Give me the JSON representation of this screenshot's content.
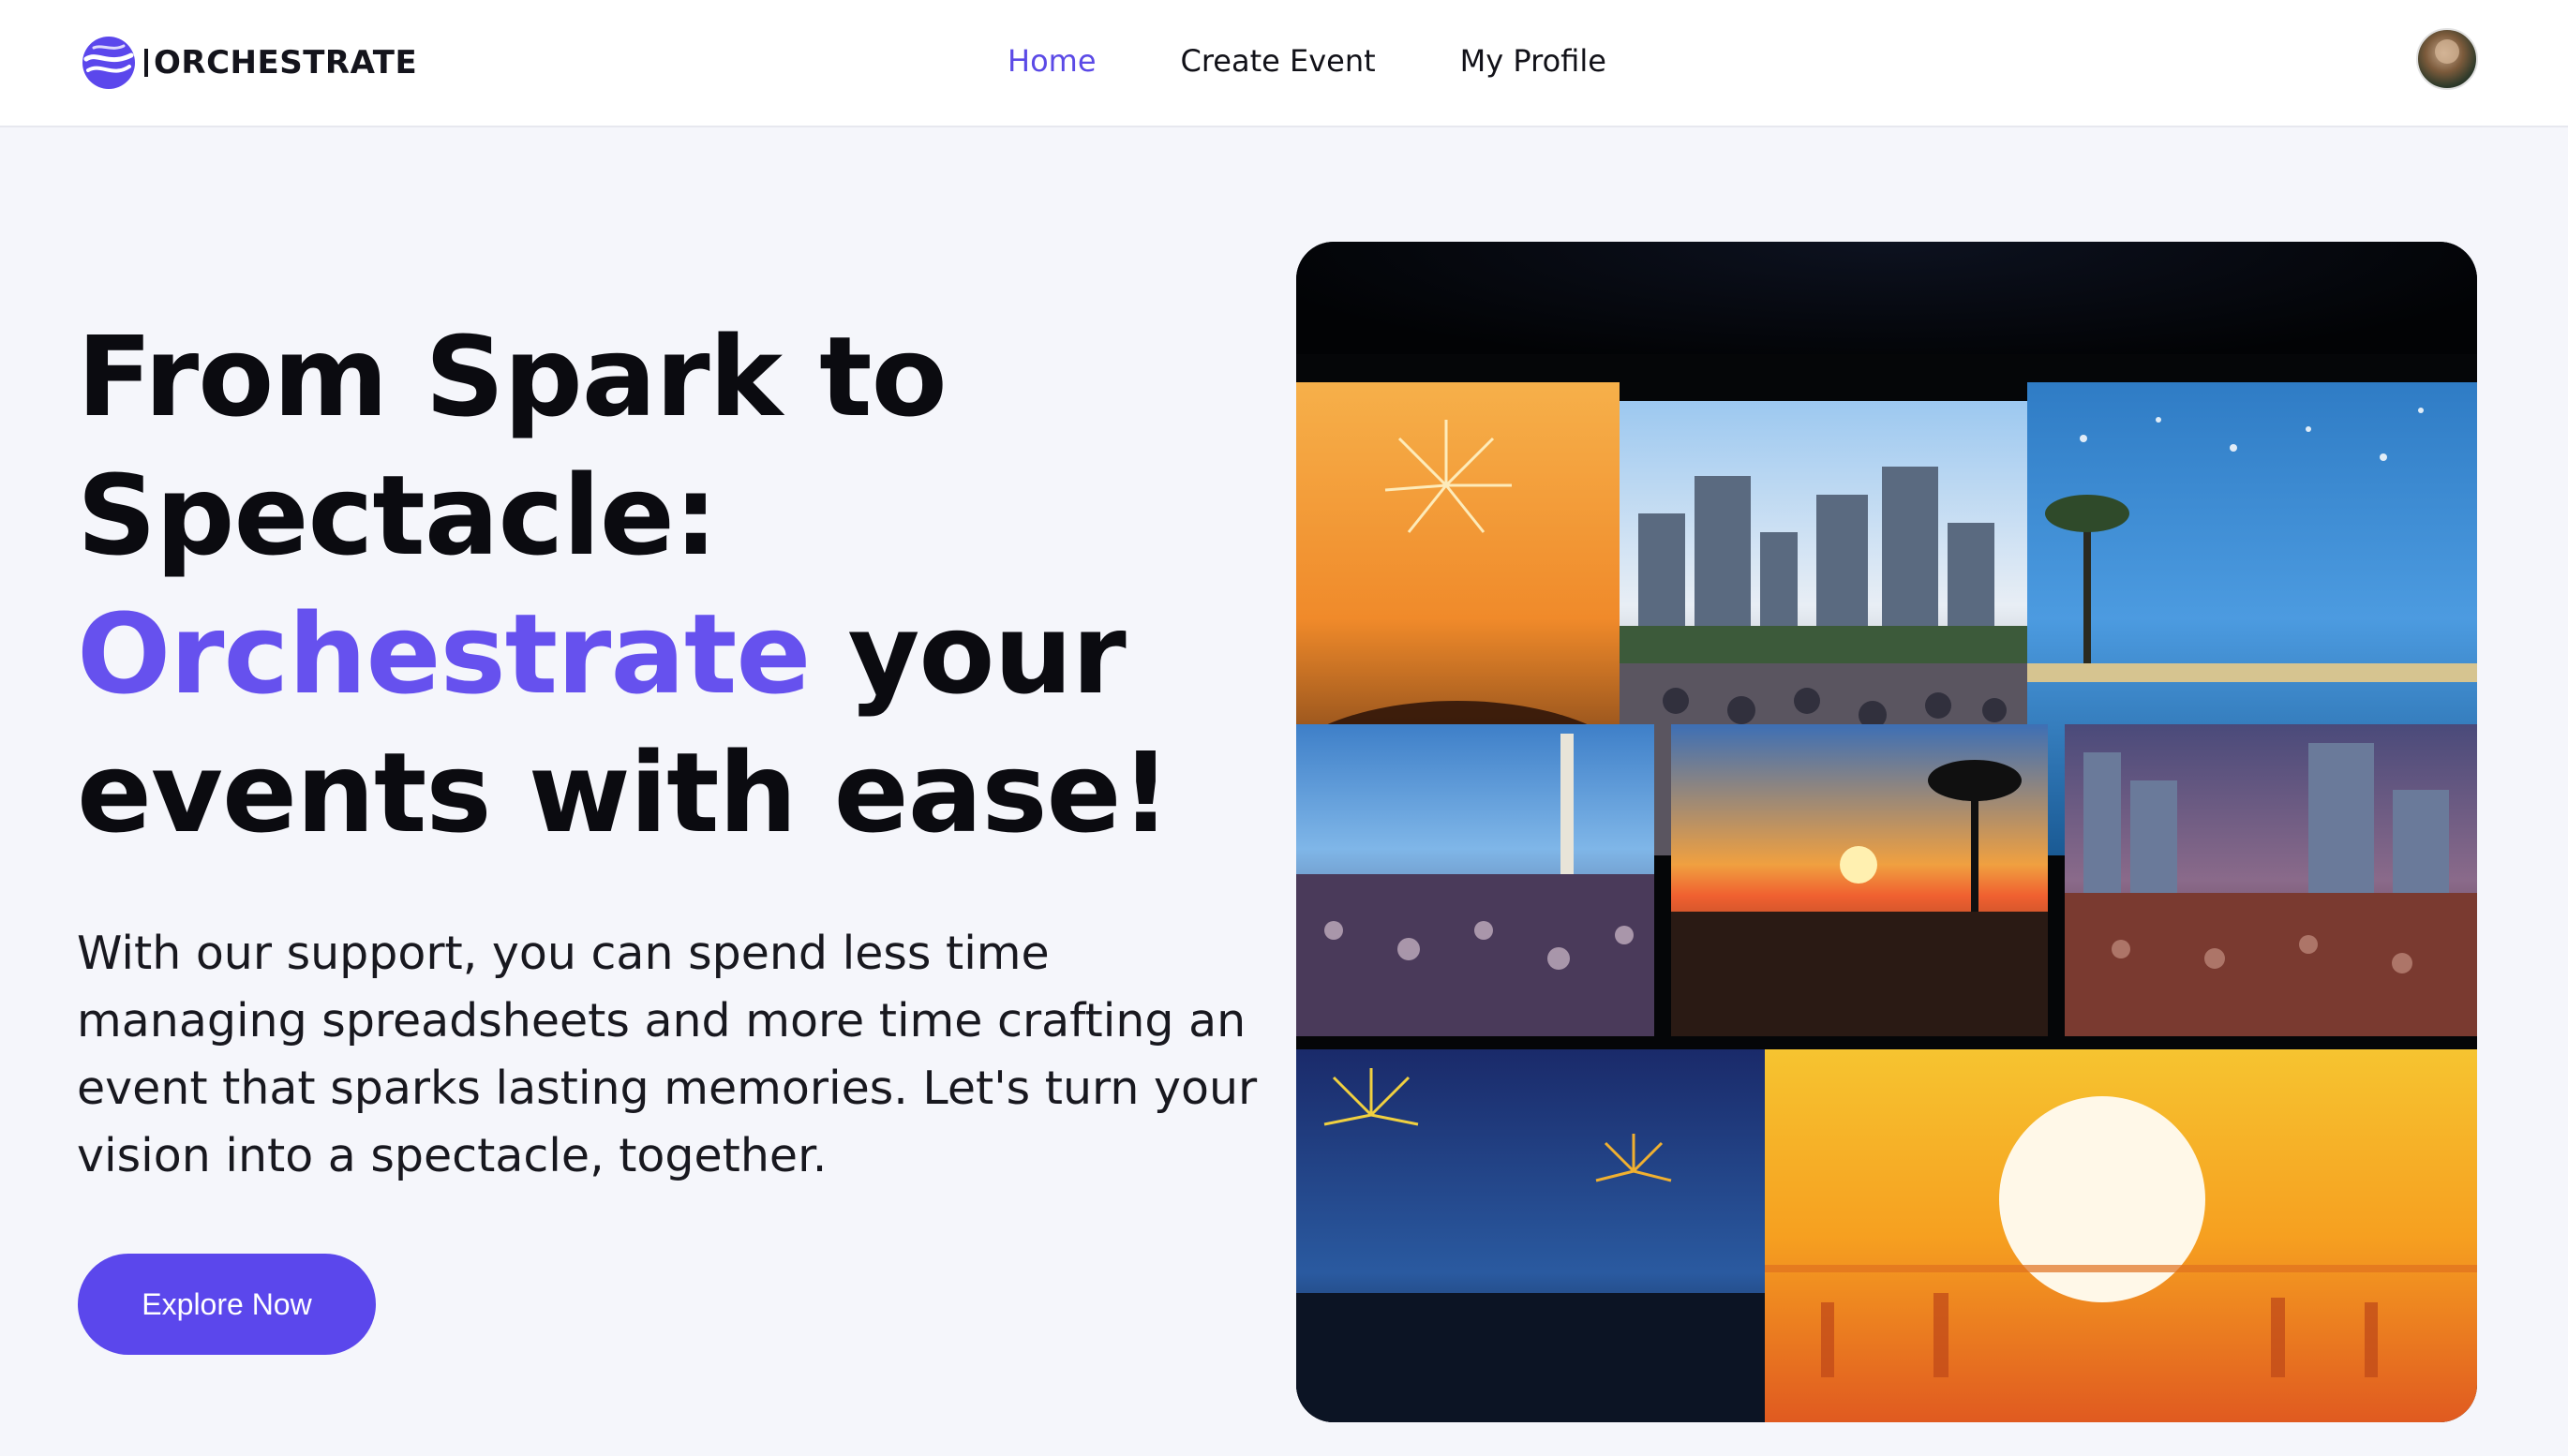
{
  "brand": {
    "name": "ORCHESTRATE",
    "accent_color": "#5b47ec",
    "logo_icon": "planet-wave-logo"
  },
  "nav": {
    "items": [
      {
        "label": "Home",
        "active": true
      },
      {
        "label": "Create Event",
        "active": false
      },
      {
        "label": "My Profile",
        "active": false
      }
    ],
    "avatar_icon": "user-avatar"
  },
  "hero": {
    "title_line1": "From Spark to",
    "title_line2": "Spectacle:",
    "title_accent": "Orchestrate",
    "title_line3_rest": " your",
    "title_line4": "events with ease!",
    "description": "With our support, you can spend less time managing spreadsheets and more time crafting an event that sparks lasting memories. Let's turn your vision into a spectacle, together.",
    "cta_label": "Explore Now"
  },
  "collage": {
    "tiles": [
      "fireworks-crowd",
      "city-skyline-crowd",
      "waterfront-night",
      "tower-crowd",
      "palm-sunset",
      "city-crowd-evening",
      "fireworks-night-crowd",
      "orange-sunset-silhouettes"
    ]
  }
}
